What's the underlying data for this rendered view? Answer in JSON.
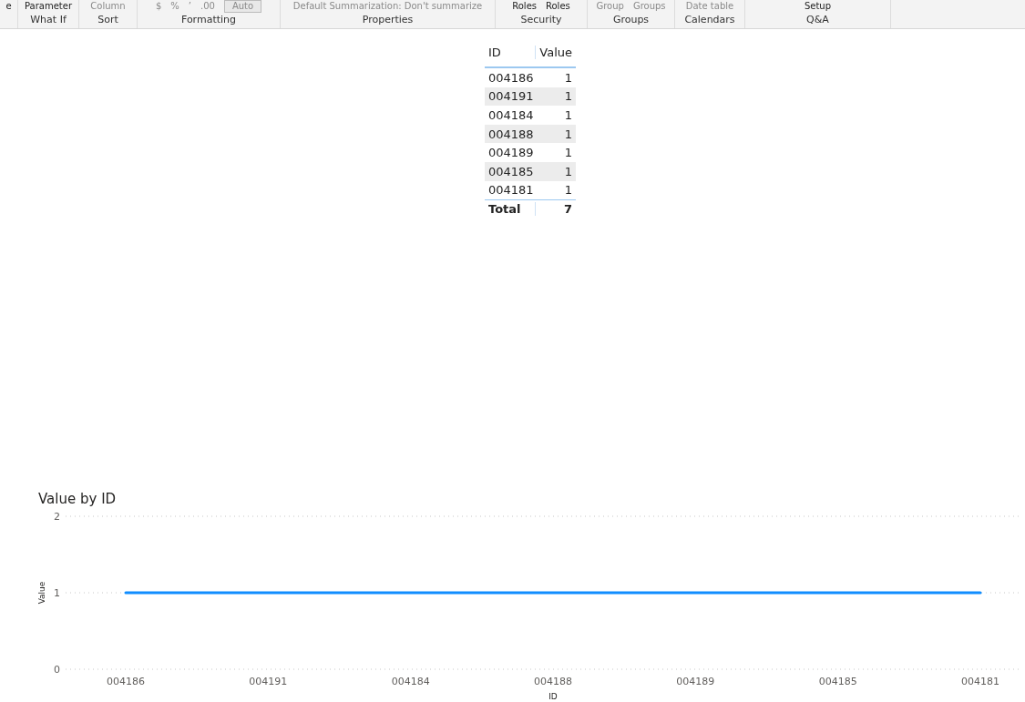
{
  "ribbon": {
    "groups": [
      {
        "items": [
          "e"
        ]
      },
      {
        "label": "What If",
        "items": [
          "Parameter"
        ]
      },
      {
        "label": "Sort",
        "items": [
          "Column"
        ]
      },
      {
        "label": "Formatting",
        "items": [
          "$",
          "%",
          "’",
          ".00",
          "Auto"
        ]
      },
      {
        "label": "Properties",
        "items": [
          "Default Summarization: Don't summarize"
        ]
      },
      {
        "label": "Security",
        "items": [
          "Roles",
          "Roles"
        ]
      },
      {
        "label": "Groups",
        "items": [
          "Group",
          "Groups"
        ]
      },
      {
        "label": "Calendars",
        "items": [
          "Date table"
        ]
      },
      {
        "label": "Q&A",
        "items": [
          "Setup"
        ]
      }
    ]
  },
  "table": {
    "columns": [
      "ID",
      "Value"
    ],
    "rows": [
      [
        "004186",
        "1"
      ],
      [
        "004191",
        "1"
      ],
      [
        "004184",
        "1"
      ],
      [
        "004188",
        "1"
      ],
      [
        "004189",
        "1"
      ],
      [
        "004185",
        "1"
      ],
      [
        "004181",
        "1"
      ]
    ],
    "total": [
      "Total",
      "7"
    ]
  },
  "chart": {
    "chart_data": {
      "type": "line",
      "title": "Value by ID",
      "xlabel": "ID",
      "ylabel": "Value",
      "categories": [
        "004186",
        "004191",
        "004184",
        "004188",
        "004189",
        "004185",
        "004181"
      ],
      "series": [
        {
          "color": "#118dff",
          "values": [
            1,
            1,
            1,
            1,
            1,
            1,
            1
          ]
        }
      ],
      "ylim": [
        0,
        2
      ],
      "yticks": [
        0,
        1,
        2
      ]
    }
  }
}
